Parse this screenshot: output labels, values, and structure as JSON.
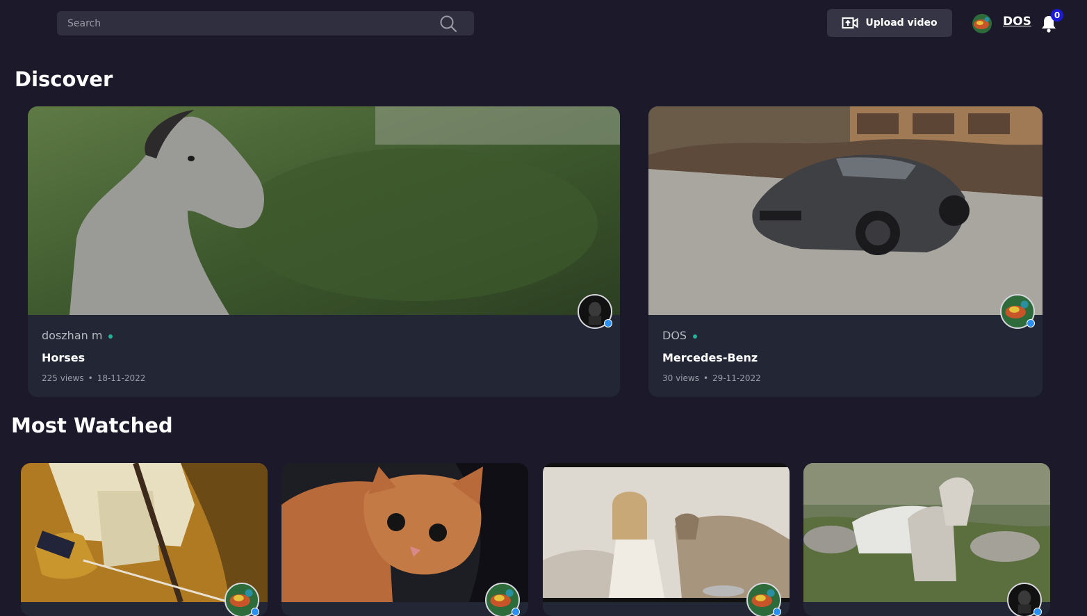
{
  "header": {
    "search_placeholder": "Search",
    "upload_label": "Upload video",
    "username": "DOS",
    "notification_count": "0"
  },
  "discover": {
    "title": "Discover",
    "videos": [
      {
        "author": "doszhan m",
        "title": "Horses",
        "views": "225 views",
        "date": "18-11-2022",
        "thumbnail": "horse-in-meadow"
      },
      {
        "author": "DOS",
        "title": "Mercedes-Benz",
        "views": "30 views",
        "date": "29-11-2022",
        "thumbnail": "gray-sports-car"
      }
    ]
  },
  "most_watched": {
    "title": "Most Watched",
    "videos": [
      {
        "thumbnail": "archer-with-bow"
      },
      {
        "thumbnail": "orange-kitten"
      },
      {
        "thumbnail": "girl-with-goats"
      },
      {
        "thumbnail": "white-horses-field"
      }
    ]
  },
  "colors": {
    "background": "#1c1a2a",
    "card": "#222635",
    "online_dot": "#22b39a",
    "badge": "#1b1bd6",
    "verified": "#2a8ff0"
  }
}
